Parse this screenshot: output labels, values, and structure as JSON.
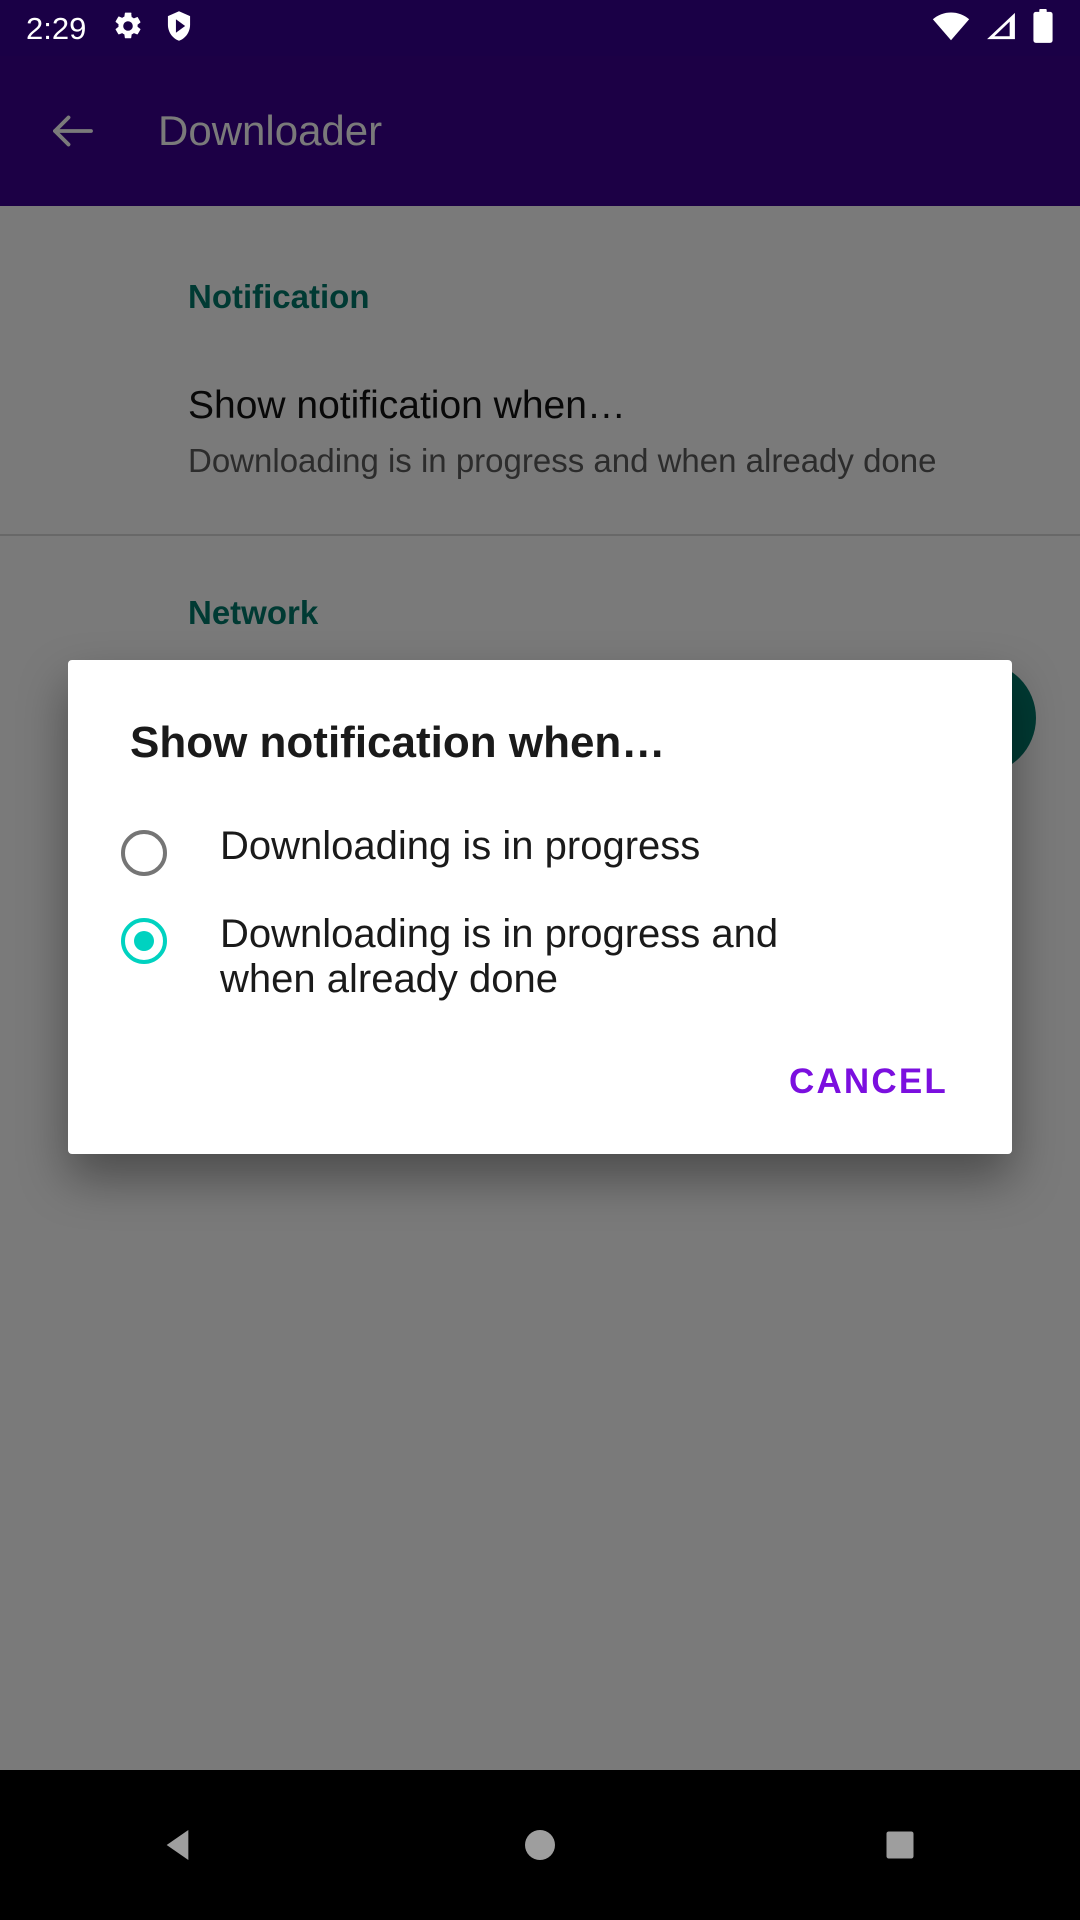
{
  "status_bar": {
    "clock": "2:29",
    "left_icons": [
      "gear-icon",
      "shield-play-icon"
    ],
    "right_icons": [
      "wifi-icon",
      "cell-signal-icon",
      "battery-icon"
    ],
    "background_color": "#1A0046",
    "foreground_color": "#FFFFFF"
  },
  "toolbar": {
    "title": "Downloader",
    "back_icon": "back-arrow-icon",
    "background_color": "#3B0090"
  },
  "content": {
    "sections": [
      {
        "header": "Notification",
        "items": [
          {
            "title": "Show notification when…",
            "summary": "Downloading is in progress and when already done"
          }
        ]
      },
      {
        "header": "Network",
        "items": []
      }
    ],
    "section_header_color": "#00796B",
    "fab": {
      "name": "add-download-fab",
      "color": "#00796B"
    }
  },
  "dialog": {
    "title": "Show notification when…",
    "options": [
      {
        "label": "Downloading is in progress",
        "selected": false
      },
      {
        "label": "Downloading is in progress and when already done",
        "selected": true
      }
    ],
    "cancel_label": "CANCEL",
    "accent_color": "#00D2C0",
    "action_color": "#7B0FDF"
  },
  "nav_bar": {
    "buttons": [
      "back-nav-icon",
      "home-nav-icon",
      "recents-nav-icon"
    ],
    "background_color": "#000000"
  }
}
